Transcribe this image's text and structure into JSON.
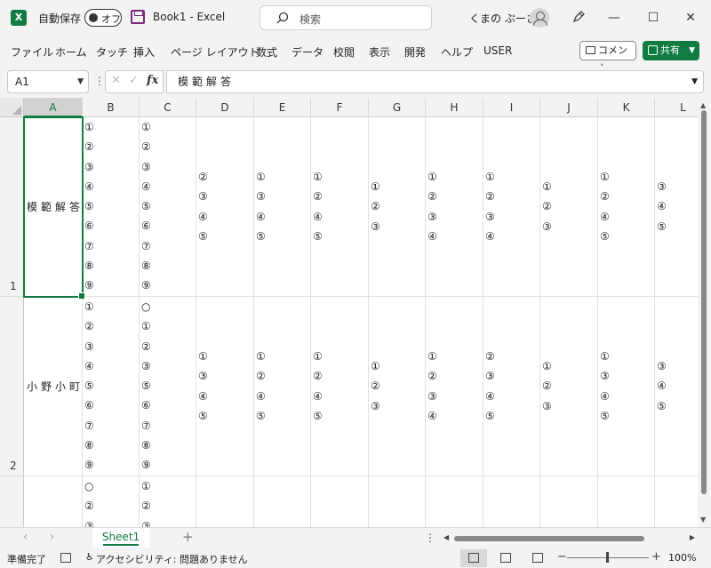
{
  "titlebar": {
    "logo": "X",
    "autosave_label": "自動保存",
    "autosave_state": "オフ",
    "doc_title": "Book1  -  Excel",
    "search_placeholder": "検索",
    "user_name": "くまの ぷーさん",
    "minimize": "—",
    "maximize": "☐",
    "close": "✕"
  },
  "menu": [
    "ファイル",
    "ホーム",
    "タッチ",
    "挿入",
    "ページ レイアウト",
    "数式",
    "データ",
    "校閲",
    "表示",
    "開発",
    "ヘルプ",
    "USER"
  ],
  "comment_label": "コメント",
  "share_label": "共有",
  "formula_bar": {
    "name_box": "A1",
    "formula": "模範解答",
    "fx": "fx",
    "dots": "⋮",
    "cancel": "✕",
    "enter": "✓"
  },
  "columns": [
    "A",
    "B",
    "C",
    "D",
    "E",
    "F",
    "G",
    "H",
    "I",
    "J",
    "K",
    "L"
  ],
  "selected_column": "A",
  "rows": [
    {
      "number": "1",
      "a": "模範解答",
      "cells": [
        "①\n②\n③\n④\n⑤\n⑥\n⑦\n⑧\n⑨",
        "①\n②\n③\n④\n⑤\n⑥\n⑦\n⑧\n⑨",
        "②\n③\n④\n⑤",
        "①\n③\n④\n⑤",
        "①\n②\n④\n⑤",
        "①\n②\n③",
        "①\n②\n③\n④",
        "①\n②\n③\n④",
        "①\n②\n③",
        "①\n②\n④\n⑤",
        "③\n④\n⑤"
      ]
    },
    {
      "number": "2",
      "a": "小野小町",
      "cells": [
        "①\n②\n③\n④\n⑤\n⑥\n⑦\n⑧\n⑨",
        "○\n①\n②\n③\n⑤\n⑥\n⑦\n⑧\n⑨",
        "①\n③\n④\n⑤",
        "①\n②\n④\n⑤",
        "①\n②\n④\n⑤",
        "①\n②\n③",
        "①\n②\n③\n④",
        "②\n③\n④\n⑤",
        "①\n②\n③",
        "①\n③\n④\n⑤",
        "③\n④\n⑤"
      ]
    },
    {
      "number": "",
      "a": "",
      "cells": [
        "○\n②\n③",
        "①\n②\n③",
        "",
        "",
        "",
        "",
        "",
        "",
        "",
        "",
        ""
      ]
    }
  ],
  "sheet_tab": "Sheet1",
  "add_sheet": "+",
  "status": {
    "ready": "準備完了",
    "accessibility": "アクセシビリティ: 問題ありません",
    "zoom": "100%"
  }
}
